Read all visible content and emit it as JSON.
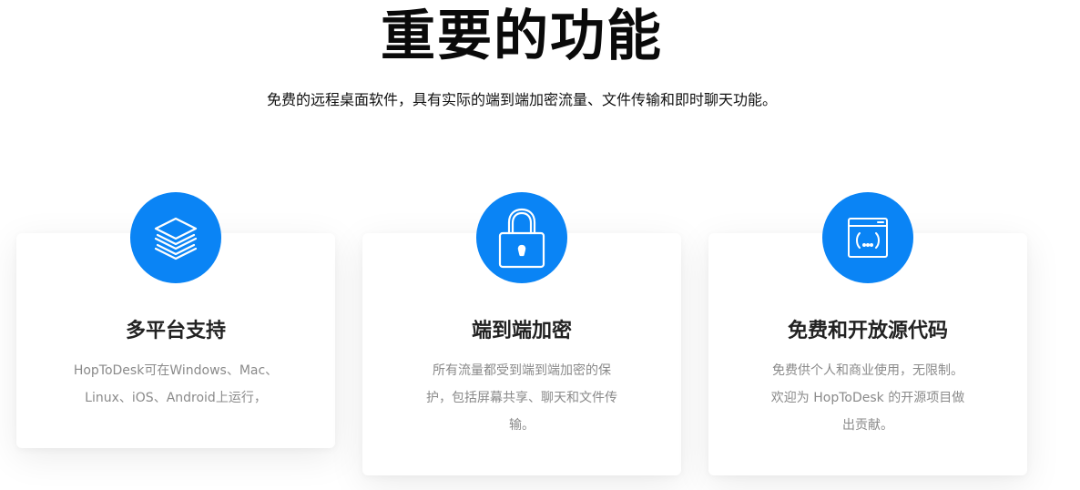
{
  "header": {
    "title": "重要的功能",
    "subtitle": "免费的远程桌面软件，具有实际的端到端加密流量、文件传输和即时聊天功能。"
  },
  "features": [
    {
      "icon": "layers-icon",
      "title": "多平台支持",
      "desc_lines": [
        "HopToDesk可在Windows、Mac、",
        "Linux、iOS、Android上运行，"
      ]
    },
    {
      "icon": "lock-icon",
      "title": "端到端加密",
      "desc_lines": [
        "所有流量都受到端到端加密的保",
        "护，包括屏幕共享、聊天和文件传",
        "输。"
      ]
    },
    {
      "icon": "code-window-icon",
      "title": "免费和开放源代码",
      "desc_lines": [
        "免费供个人和商业使用，无限制。",
        "欢迎为 HopToDesk 的开源项目做",
        "出贡献。"
      ]
    }
  ],
  "colors": {
    "accent": "#0a84f5",
    "title": "#0a0a0a",
    "card_title": "#222222",
    "desc": "#8a8a8a"
  }
}
